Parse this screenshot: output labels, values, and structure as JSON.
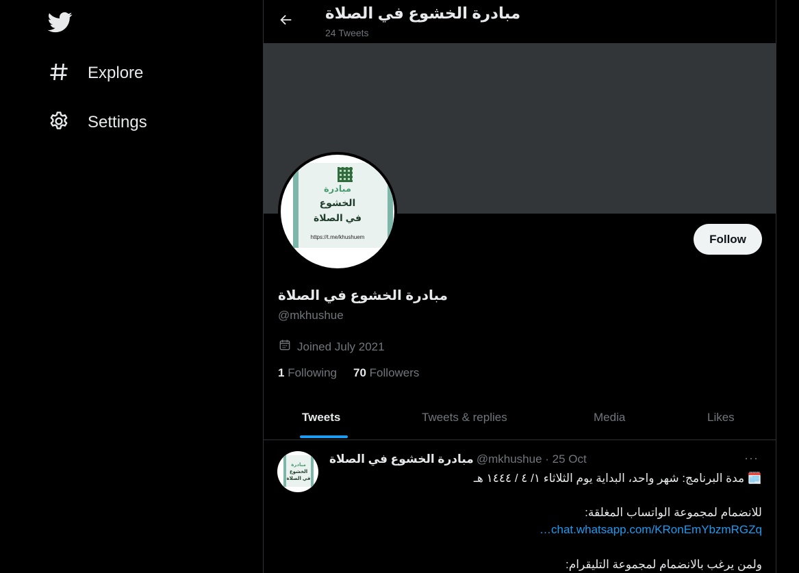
{
  "sidebar": {
    "items": [
      {
        "label": "Explore"
      },
      {
        "label": "Settings"
      }
    ]
  },
  "header": {
    "title": "مبادرة الخشوع في الصلاة",
    "subtitle": "24 Tweets"
  },
  "profile": {
    "avatar_text": {
      "line1": "مبادرة",
      "line2": "الخشوع",
      "line3": "في الصلاة",
      "url": "https://t.me/khushuem"
    },
    "follow_label": "Follow",
    "name": "مبادرة الخشوع في الصلاة",
    "handle": "@mkhushue",
    "joined": "Joined July 2021",
    "following_count": "1",
    "following_label": "Following",
    "followers_count": "70",
    "followers_label": "Followers"
  },
  "tabs": [
    {
      "label": "Tweets"
    },
    {
      "label": "Tweets & replies"
    },
    {
      "label": "Media"
    },
    {
      "label": "Likes"
    }
  ],
  "tweet": {
    "name": "مبادرة الخشوع في الصلاة",
    "meta": "@mkhushue · 25 Oct",
    "more": "···",
    "line1": "🗓️ مدة البرنامج: شهر واحد، البداية يوم الثلاثاء ١/ ٤ / ١٤٤٤ هـ",
    "line2": "للانضمام لمجموعة الواتساب المغلقة:",
    "link": "chat.whatsapp.com/KRonEmYbzmRGZq…",
    "line3": "ولمن يرغب بالانضمام لمجموعة التليقرام:"
  },
  "colors": {
    "accent": "#1d9bf0",
    "background": "#000000",
    "banner": "#333639",
    "muted_text": "#71767b"
  },
  "icons": [
    "twitter-logo-icon",
    "hashtag-icon",
    "gear-icon",
    "back-arrow-icon",
    "calendar-icon",
    "more-icon"
  ]
}
